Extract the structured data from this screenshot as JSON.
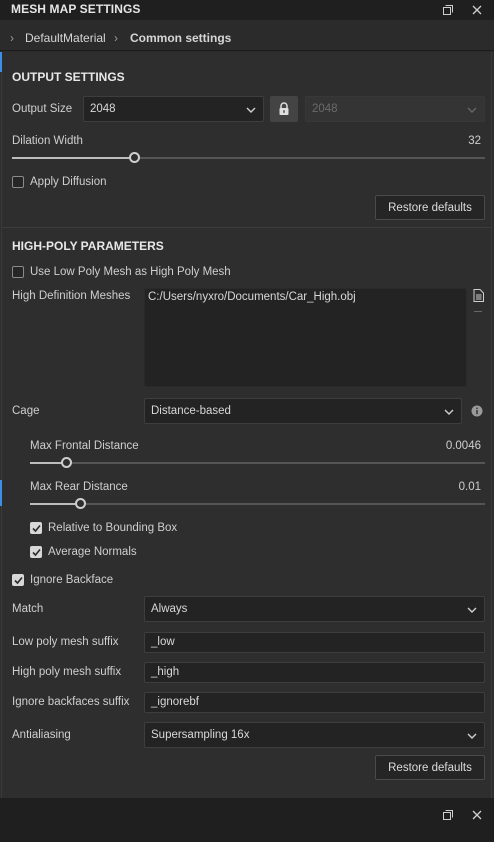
{
  "window": {
    "title": "MESH MAP SETTINGS"
  },
  "breadcrumb": {
    "items": [
      "DefaultMaterial",
      "Common settings"
    ]
  },
  "output": {
    "section_title": "OUTPUT SETTINGS",
    "output_size_label": "Output Size",
    "output_size_value": "2048",
    "output_size_locked_value": "2048",
    "dilation_label": "Dilation Width",
    "dilation_value": "32",
    "dilation_fraction": 0.26,
    "apply_diffusion_label": "Apply Diffusion",
    "apply_diffusion_checked": false,
    "restore_label": "Restore defaults"
  },
  "highpoly": {
    "section_title": "HIGH-POLY PARAMETERS",
    "use_low_as_high_label": "Use Low Poly Mesh as High Poly Mesh",
    "use_low_as_high_checked": false,
    "hd_meshes_label": "High Definition Meshes",
    "hd_meshes_value": "C:/Users/nyxro/Documents/Car_High.obj",
    "cage_label": "Cage",
    "cage_value": "Distance-based",
    "max_frontal_label": "Max Frontal Distance",
    "max_frontal_value": "0.0046",
    "max_frontal_fraction": 0.08,
    "max_rear_label": "Max Rear Distance",
    "max_rear_value": "0.01",
    "max_rear_fraction": 0.11,
    "relative_bbox_label": "Relative to Bounding Box",
    "relative_bbox_checked": true,
    "average_normals_label": "Average Normals",
    "average_normals_checked": true,
    "ignore_backface_label": "Ignore Backface",
    "ignore_backface_checked": true,
    "match_label": "Match",
    "match_value": "Always",
    "low_suffix_label": "Low poly mesh suffix",
    "low_suffix_value": "_low",
    "high_suffix_label": "High poly mesh suffix",
    "high_suffix_value": "_high",
    "ignore_bf_suffix_label": "Ignore backfaces suffix",
    "ignore_bf_suffix_value": "_ignorebf",
    "antialiasing_label": "Antialiasing",
    "antialiasing_value": "Supersampling 16x",
    "restore_label": "Restore defaults"
  },
  "colors": {
    "accent": "#3d8ee6",
    "background": "#2e2e2e",
    "field": "#232323"
  }
}
